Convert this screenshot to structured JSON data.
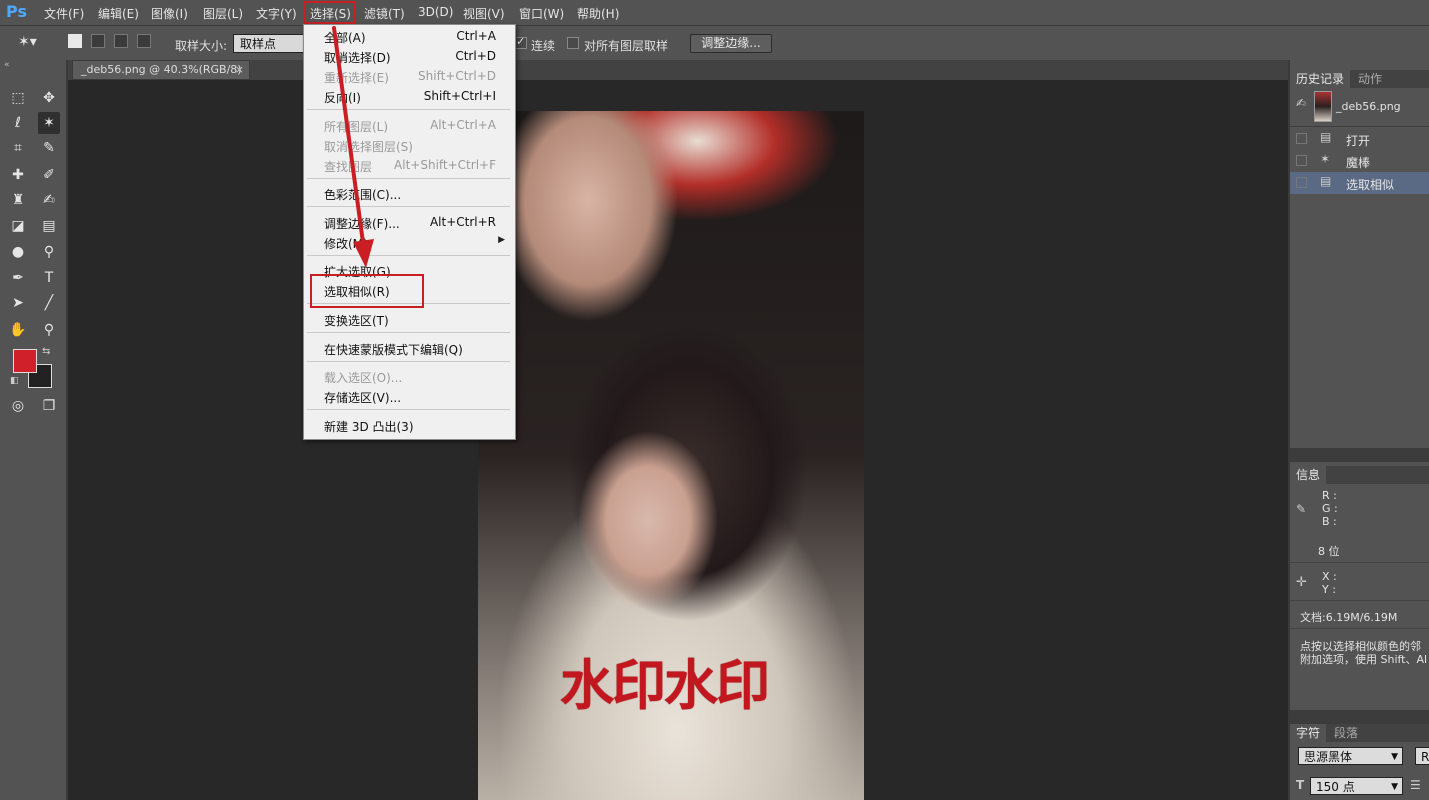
{
  "app": {
    "logo": "Ps"
  },
  "menubar": [
    "文件(F)",
    "编辑(E)",
    "图像(I)",
    "图层(L)",
    "文字(Y)",
    "选择(S)",
    "滤镜(T)",
    "3D(D)",
    "视图(V)",
    "窗口(W)",
    "帮助(H)"
  ],
  "options": {
    "sample_size_label": "取样大小:",
    "sample_size_value": "取样点",
    "contiguous_label": "连续",
    "contiguous_checked": true,
    "all_layers_label": "对所有图层取样",
    "all_layers_checked": false,
    "refine_edge_button": "调整边缘..."
  },
  "document": {
    "tab_title": "_deb56.png @ 40.3%(RGB/8)",
    "close_glyph": "×",
    "watermark_text": "水印水印"
  },
  "select_menu": {
    "items": [
      {
        "label": "全部(A)",
        "shortcut": "Ctrl+A",
        "disabled": false
      },
      {
        "label": "取消选择(D)",
        "shortcut": "Ctrl+D",
        "disabled": false
      },
      {
        "label": "重新选择(E)",
        "shortcut": "Shift+Ctrl+D",
        "disabled": true
      },
      {
        "label": "反向(I)",
        "shortcut": "Shift+Ctrl+I",
        "disabled": false
      },
      {
        "label": "所有图层(L)",
        "shortcut": "Alt+Ctrl+A",
        "disabled": true
      },
      {
        "label": "取消选择图层(S)",
        "shortcut": "",
        "disabled": true
      },
      {
        "label": "查找图层",
        "shortcut": "Alt+Shift+Ctrl+F",
        "disabled": true
      },
      {
        "label": "色彩范围(C)...",
        "shortcut": "",
        "disabled": false
      },
      {
        "label": "调整边缘(F)...",
        "shortcut": "Alt+Ctrl+R",
        "disabled": false
      },
      {
        "label": "修改(M)",
        "shortcut": "",
        "disabled": false
      },
      {
        "label": "扩大选取(G)",
        "shortcut": "",
        "disabled": false
      },
      {
        "label": "选取相似(R)",
        "shortcut": "",
        "disabled": false
      },
      {
        "label": "变换选区(T)",
        "shortcut": "",
        "disabled": false
      },
      {
        "label": "在快速蒙版模式下编辑(Q)",
        "shortcut": "",
        "disabled": false
      },
      {
        "label": "载入选区(O)...",
        "shortcut": "",
        "disabled": true
      },
      {
        "label": "存储选区(V)...",
        "shortcut": "",
        "disabled": false
      },
      {
        "label": "新建 3D 凸出(3)",
        "shortcut": "",
        "disabled": false
      }
    ],
    "submenu_glyph": "▶"
  },
  "history_panel": {
    "tabs": [
      "历史记录",
      "动作"
    ],
    "snapshot_name": "_deb56.png",
    "steps": [
      "打开",
      "魔棒",
      "选取相似"
    ],
    "selected_step": "选取相似"
  },
  "info_panel": {
    "tab": "信息",
    "r_label": "R :",
    "g_label": "G :",
    "b_label": "B :",
    "bit_depth": "8 位",
    "x_label": "X :",
    "y_label": "Y :",
    "doc_size": "文档:6.19M/6.19M",
    "hint_line1": "点按以选择相似颜色的邻",
    "hint_line2": "附加选项，使用 Shift、Al"
  },
  "character_panel": {
    "tabs": [
      "字符",
      "段落"
    ],
    "font_family": "思源黑体",
    "font_style_partial": "Re",
    "font_size": "150 点"
  },
  "colors": {
    "foreground": "#d0202a",
    "background": "#222222",
    "highlight": "#c81e24"
  },
  "tools": [
    "marquee-icon",
    "move-icon",
    "lasso-icon",
    "magic-wand-icon",
    "crop-icon",
    "eyedropper-icon",
    "healing-brush-icon",
    "brush-icon",
    "clone-stamp-icon",
    "history-brush-icon",
    "eraser-icon",
    "gradient-icon",
    "blur-icon",
    "dodge-icon",
    "pen-icon",
    "text-icon",
    "path-selection-icon",
    "line-icon",
    "hand-icon",
    "zoom-icon"
  ]
}
